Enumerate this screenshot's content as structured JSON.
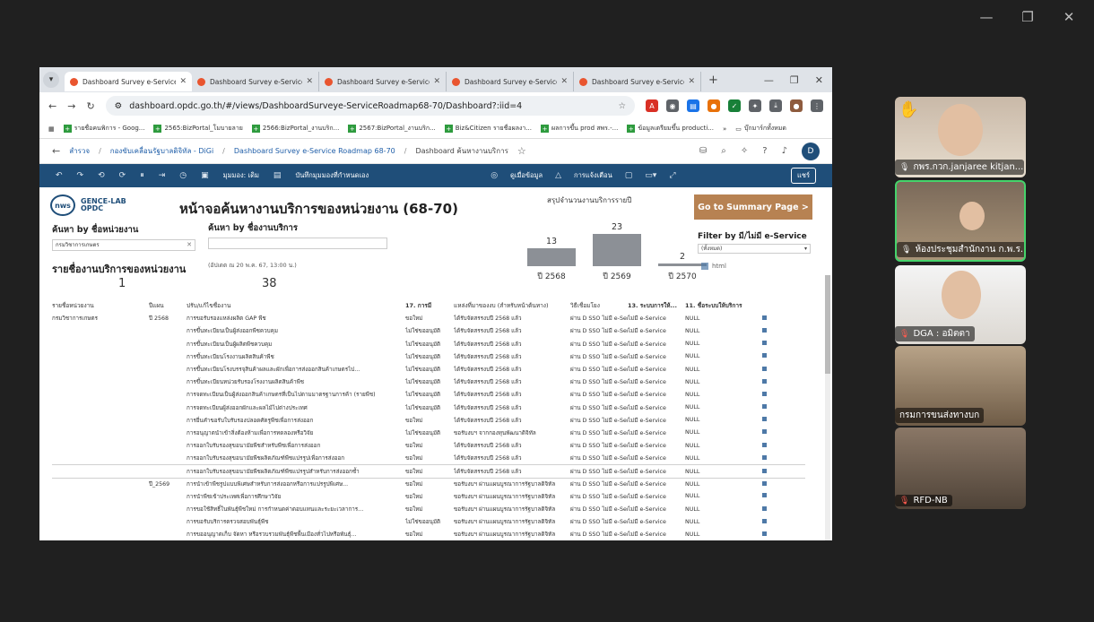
{
  "meeting": {
    "controls": [
      "—",
      "❐",
      "✕"
    ],
    "participants": [
      {
        "name": "กพร.กวก.janjaree kitjan...",
        "mic": "on",
        "hand_raised": true
      },
      {
        "name": "ห้องประชุมสำนักงาน ก.พ.ร.",
        "mic": "on",
        "active_speaker": true
      },
      {
        "name": "DGA : อมิตตา",
        "mic": "off"
      },
      {
        "name": "กรมการขนส่งทางบก",
        "mic": "none"
      },
      {
        "name": "RFD-NB",
        "mic": "off"
      }
    ]
  },
  "browser": {
    "tabs": [
      {
        "title": "Dashboard Survey e-Service Roa",
        "active": true
      },
      {
        "title": "Dashboard Survey e-Service Roa"
      },
      {
        "title": "Dashboard Survey e-Service Roa"
      },
      {
        "title": "Dashboard Survey e-Service Roa"
      },
      {
        "title": "Dashboard Survey e-Service Roa"
      }
    ],
    "new_tab": "+",
    "url": "dashboard.opdc.go.th/#/views/DashboardSurveye-ServiceRoadmap68-70/Dashboard?:iid=4",
    "bookmarks": [
      "รายชื่อคนพิการ - Goog...",
      "2565:BizPortal_โมบายลาย",
      "2566:BizPortal_งานบริก...",
      "2567:BizPortal_งานบริก...",
      "Biz&Citizen รายชื่อผลงา...",
      "ผลการขึ้น prod สพร.-...",
      "ข้อมูลเตรียมขึ้น producti..."
    ],
    "bookmarks_folder": "บุ๊กมาร์กทั้งหมด"
  },
  "tableau": {
    "breadcrumb": [
      "สำรวจ",
      "กองขับเคลื่อนรัฐบาลดิจิทัล - DiGi",
      "Dashboard Survey e-Service Roadmap 68-70",
      "Dashboard ค้นหางานบริการ"
    ],
    "toolbar": {
      "view_label": "มุมมอง: เดิม",
      "save_label": "บันทึกมุมมองที่กำหนดเอง",
      "watch_label": "ดูเมื่อข้อมูล",
      "alert_label": "การแจ้งเตือน",
      "share_label": "แชร์"
    },
    "avatar": "D"
  },
  "dashboard": {
    "logo1": "nws",
    "logo2_line1": "GENCE-LAB",
    "logo2_line2": "OPDC",
    "title": "หน้าจอค้นหางานบริการของหน่วยงาน (68-70)",
    "search_agency_label": "ค้นหา by ชื่อหน่วยงาน",
    "search_agency_value": "กรมวิชาการเกษตร",
    "search_service_label": "ค้นหา by ชื่องานบริการ",
    "summary_title": "สรุปจำนวนงานบริการรายปี",
    "goto_button": "Go to Summary Page >",
    "filter_label": "Filter by มี/ไม่มี e-Service",
    "filter_value": "(ทั้งหมด)",
    "legend_item": "html",
    "list_title": "รายชื่องานบริการของหน่วยงาน",
    "updated_text": "(อัปเดต ณ 20 พ.ค. 67, 13:00 น.)",
    "agency_count": "1",
    "service_count": "38",
    "columns": [
      "รายชื่อหน่วยงาน",
      "ปีแผน",
      "ปรับ/แก้ไขชื่องาน",
      "17. การมี",
      "แหล่งที่มาของงบ (สำหรับหน้าต้นทาง)",
      "วิธีเชื่อมโยง",
      "13. ระบบการให้...",
      "11. ชื่อระบบให้บริการ",
      ""
    ],
    "rows": [
      {
        "agency": "กรมวิชาการเกษตร",
        "year": "ปี 2568",
        "service": "การขอรับรองแหล่งผลิต GAP พืช",
        "status": "ขอใหม่",
        "budget": "ได้รับจัดสรรงบปี 2568 แล้ว",
        "link": "ผ่าน D SSO ไม่มี e-Service",
        "system": "ไม่มี e-Service",
        "name": "NULL"
      },
      {
        "agency": "",
        "year": "",
        "service": "การขึ้นทะเบียนเป็นผู้ส่งออกพืชควบคุม",
        "status": "ไม่ใช่ขออนุมัติ",
        "budget": "ได้รับจัดสรรงบปี 2568 แล้ว",
        "link": "ผ่าน D SSO ไม่มี e-Service",
        "system": "ไม่มี e-Service",
        "name": "NULL"
      },
      {
        "agency": "",
        "year": "",
        "service": "การขึ้นทะเบียนเป็นผู้ผลิตพืชควบคุม",
        "status": "ไม่ใช่ขออนุมัติ",
        "budget": "ได้รับจัดสรรงบปี 2568 แล้ว",
        "link": "ผ่าน D SSO ไม่มี e-Service",
        "system": "ไม่มี e-Service",
        "name": "NULL"
      },
      {
        "agency": "",
        "year": "",
        "service": "การขึ้นทะเบียนโรงงานผลิตสินค้าพืช",
        "status": "ไม่ใช่ขออนุมัติ",
        "budget": "ได้รับจัดสรรงบปี 2568 แล้ว",
        "link": "ผ่าน D SSO ไม่มี e-Service",
        "system": "ไม่มี e-Service",
        "name": "NULL"
      },
      {
        "agency": "",
        "year": "",
        "service": "การขึ้นทะเบียนโรงบรรจุสินค้าผลและผักเพื่อการส่งออกสินค้าเกษตรไป...",
        "status": "ไม่ใช่ขออนุมัติ",
        "budget": "ได้รับจัดสรรงบปี 2568 แล้ว",
        "link": "ผ่าน D SSO ไม่มี e-Service",
        "system": "ไม่มี e-Service",
        "name": "NULL"
      },
      {
        "agency": "",
        "year": "",
        "service": "การขึ้นทะเบียนหน่วยรับรองโรงงานผลิตสินค้าพืช",
        "status": "ไม่ใช่ขออนุมัติ",
        "budget": "ได้รับจัดสรรงบปี 2568 แล้ว",
        "link": "ผ่าน D SSO ไม่มี e-Service",
        "system": "ไม่มี e-Service",
        "name": "NULL"
      },
      {
        "agency": "",
        "year": "",
        "service": "การจดทะเบียนเป็นผู้ส่งออกสินค้าเกษตรที่เป็นไปตามมาตรฐานการค้า (รายพืช)",
        "status": "ไม่ใช่ขออนุมัติ",
        "budget": "ได้รับจัดสรรงบปี 2568 แล้ว",
        "link": "ผ่าน D SSO ไม่มี e-Service",
        "system": "ไม่มี e-Service",
        "name": "NULL"
      },
      {
        "agency": "",
        "year": "",
        "service": "การจดทะเบียนผู้ส่งออกผักและผลไม้ไปต่างประเทศ",
        "status": "ไม่ใช่ขออนุมัติ",
        "budget": "ได้รับจัดสรรงบปี 2568 แล้ว",
        "link": "ผ่าน D SSO ไม่มี e-Service",
        "system": "ไม่มี e-Service",
        "name": "NULL"
      },
      {
        "agency": "",
        "year": "",
        "service": "การยื่นคำขอรับใบรับรองปลอดศัตรูพืชเพื่อการส่งออก",
        "status": "ขอใหม่",
        "budget": "ได้รับจัดสรรงบปี 2568 แล้ว",
        "link": "ผ่าน D SSO ไม่มี e-Service",
        "system": "ไม่มี e-Service",
        "name": "NULL"
      },
      {
        "agency": "",
        "year": "",
        "service": "การอนุญาตนำเข้าสิ่งต้องห้ามเพื่อการทดลองหรือวิจัย",
        "status": "ไม่ใช่ขออนุมัติ",
        "budget": "ขอรับงบฯ จากกองทุนพัฒนาดิจิทัล",
        "link": "ผ่าน D SSO ไม่มี e-Service",
        "system": "ไม่มี e-Service",
        "name": "NULL"
      },
      {
        "agency": "",
        "year": "",
        "service": "การออกใบรับรองสุขอนามัยพืชสำหรับพืชเพื่อการส่งออก",
        "status": "ขอใหม่",
        "budget": "ได้รับจัดสรรงบปี 2568 แล้ว",
        "link": "ผ่าน D SSO ไม่มี e-Service",
        "system": "ไม่มี e-Service",
        "name": "NULL"
      },
      {
        "agency": "",
        "year": "",
        "service": "การออกใบรับรองสุขอนามัยพืชผลิตภัณฑ์พืชแปรรูปเพื่อการส่งออก",
        "status": "ขอใหม่",
        "budget": "ได้รับจัดสรรงบปี 2568 แล้ว",
        "link": "ผ่าน D SSO ไม่มี e-Service",
        "system": "ไม่มี e-Service",
        "name": "NULL"
      },
      {
        "agency": "",
        "year": "",
        "service": "การออกใบรับรองสุขอนามัยพืชผลิตภัณฑ์พืชแปรรูปสำหรับการส่งออกซ้ำ",
        "status": "ขอใหม่",
        "budget": "ได้รับจัดสรรงบปี 2568 แล้ว",
        "link": "ผ่าน D SSO ไม่มี e-Service",
        "system": "ไม่มี e-Service",
        "name": "NULL"
      },
      {
        "agency": "",
        "year": "ปี_2569",
        "service": "การนำเข้าพืชรูปแบบพิเศษสำหรับการส่งออกหรือการแปรรูปพิเศษ...",
        "status": "ขอใหม่",
        "budget": "ขอรับงบฯ ผ่านแผนบูรณาการรัฐบาลดิจิทัล",
        "link": "ผ่าน D SSO ไม่มี e-Service",
        "system": "ไม่มี e-Service",
        "name": "NULL"
      },
      {
        "agency": "",
        "year": "",
        "service": "การนำพืชเข้าประเทศเพื่อการศึกษาวิจัย",
        "status": "ขอใหม่",
        "budget": "ขอรับงบฯ ผ่านแผนบูรณาการรัฐบาลดิจิทัล",
        "link": "ผ่าน D SSO ไม่มี e-Service",
        "system": "ไม่มี e-Service",
        "name": "NULL"
      },
      {
        "agency": "",
        "year": "",
        "service": "การขอใช้สิทธิ์ในพันธุ์พืชใหม่ การกำหนดค่าตอบแทนและระยะเวลาการ...",
        "status": "ขอใหม่",
        "budget": "ขอรับงบฯ ผ่านแผนบูรณาการรัฐบาลดิจิทัล",
        "link": "ผ่าน D SSO ไม่มี e-Service",
        "system": "ไม่มี e-Service",
        "name": "NULL"
      },
      {
        "agency": "",
        "year": "",
        "service": "การขอรับบริการตรวจสอบพันธุ์พืช",
        "status": "ไม่ใช่ขออนุมัติ",
        "budget": "ขอรับงบฯ ผ่านแผนบูรณาการรัฐบาลดิจิทัล",
        "link": "ผ่าน D SSO ไม่มี e-Service",
        "system": "ไม่มี e-Service",
        "name": "NULL"
      },
      {
        "agency": "",
        "year": "",
        "service": "การขออนุญาตเก็บ จัดหา หรือรวบรวมพันธุ์พืชพื้นเมืองทั่วไปหรือพันธุ์...",
        "status": "ขอใหม่",
        "budget": "ขอรับงบฯ ผ่านแผนบูรณาการรัฐบาลดิจิทัล",
        "link": "ผ่าน D SSO ไม่มี e-Service",
        "system": "ไม่มี e-Service",
        "name": "NULL"
      }
    ]
  },
  "chart_data": {
    "type": "bar",
    "title": "สรุปจำนวนงานบริการรายปี",
    "categories": [
      "ปี 2568",
      "ปี 2569",
      "ปี 2570"
    ],
    "values": [
      13,
      23,
      2
    ],
    "ylim": [
      0,
      23
    ],
    "color": "#8c9096"
  }
}
